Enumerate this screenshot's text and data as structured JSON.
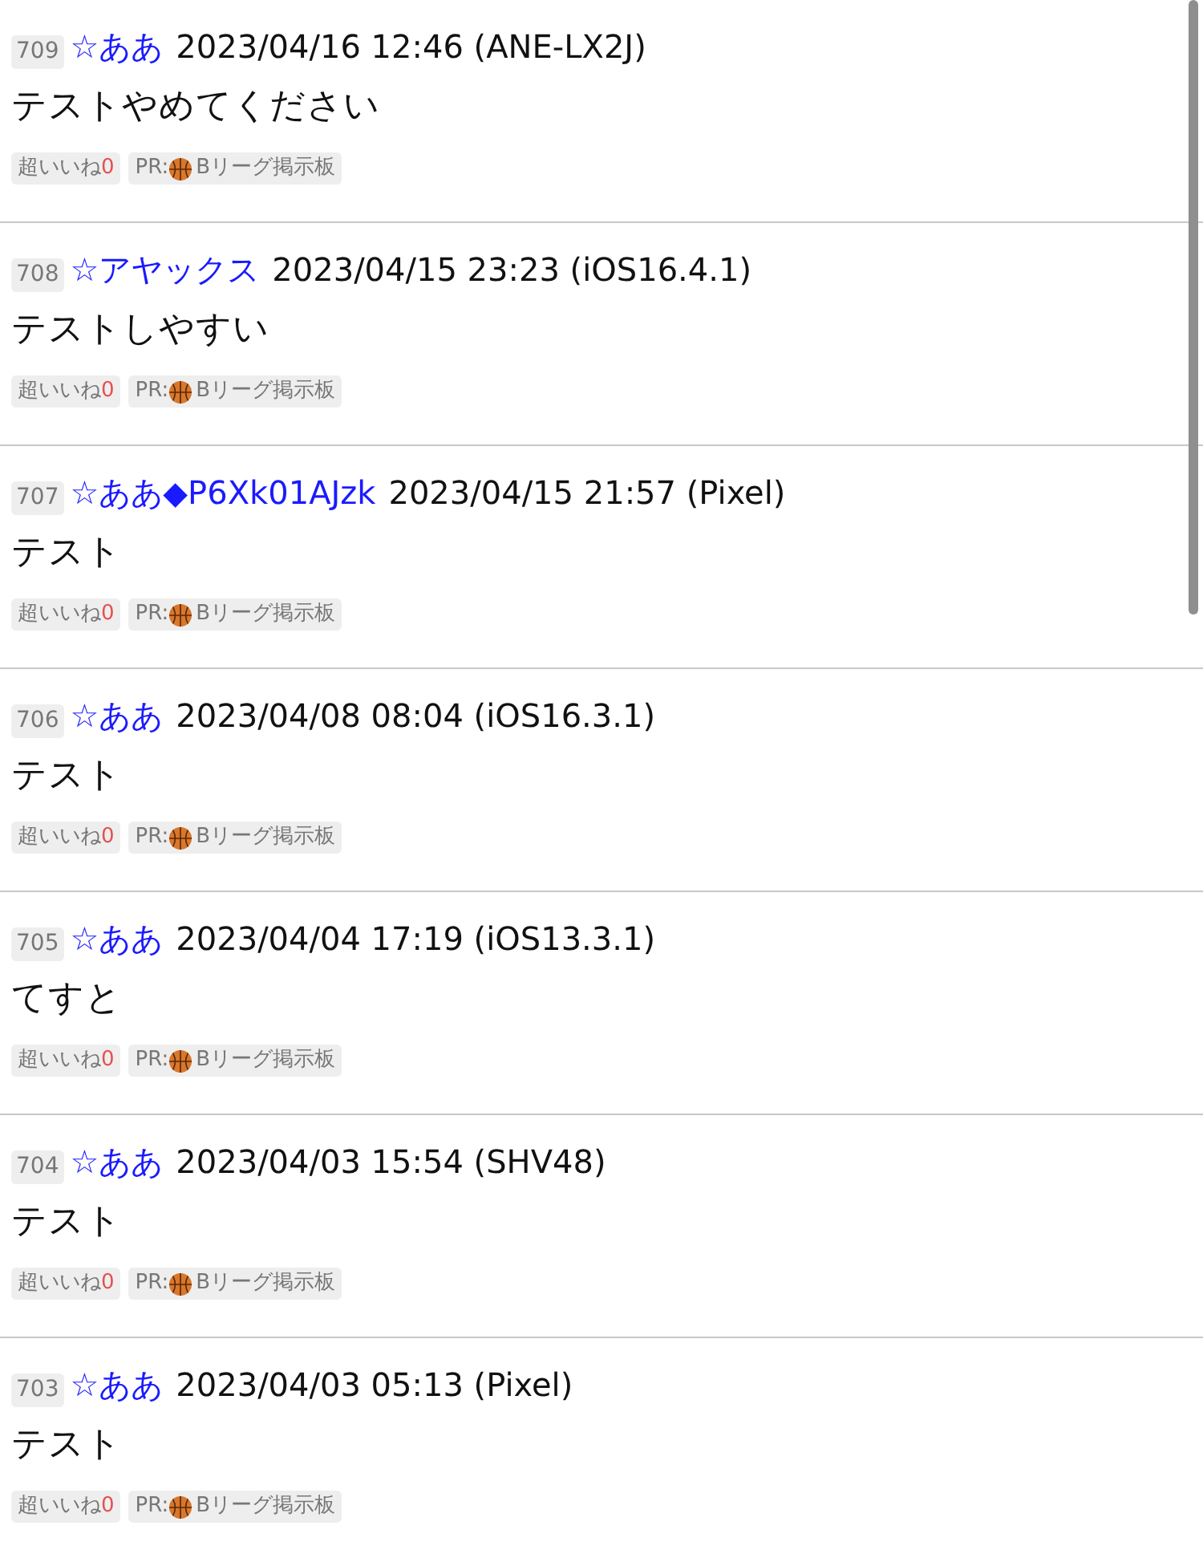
{
  "posts": [
    {
      "number": "709",
      "name": "☆ああ",
      "meta": "2023/04/16 12:46 (ANE-LX2J)",
      "body": "テストやめてください",
      "like_label": "超いいね",
      "like_count": "0",
      "pr_prefix": "PR:",
      "pr_text": "Bリーグ掲示板"
    },
    {
      "number": "708",
      "name": "☆アヤックス",
      "meta": "2023/04/15 23:23 (iOS16.4.1)",
      "body": "テストしやすい",
      "like_label": "超いいね",
      "like_count": "0",
      "pr_prefix": "PR:",
      "pr_text": "Bリーグ掲示板"
    },
    {
      "number": "707",
      "name": "☆ああ◆P6Xk01AJzk",
      "meta": "2023/04/15 21:57 (Pixel)",
      "body": "テスト",
      "like_label": "超いいね",
      "like_count": "0",
      "pr_prefix": "PR:",
      "pr_text": "Bリーグ掲示板"
    },
    {
      "number": "706",
      "name": "☆ああ",
      "meta": "2023/04/08 08:04 (iOS16.3.1)",
      "body": "テスト",
      "like_label": "超いいね",
      "like_count": "0",
      "pr_prefix": "PR:",
      "pr_text": "Bリーグ掲示板"
    },
    {
      "number": "705",
      "name": "☆ああ",
      "meta": "2023/04/04 17:19 (iOS13.3.1)",
      "body": "てすと",
      "like_label": "超いいね",
      "like_count": "0",
      "pr_prefix": "PR:",
      "pr_text": "Bリーグ掲示板"
    },
    {
      "number": "704",
      "name": "☆ああ",
      "meta": "2023/04/03 15:54 (SHV48)",
      "body": "テスト",
      "like_label": "超いいね",
      "like_count": "0",
      "pr_prefix": "PR:",
      "pr_text": "Bリーグ掲示板"
    },
    {
      "number": "703",
      "name": "☆ああ",
      "meta": "2023/04/03 05:13 (Pixel)",
      "body": "テスト",
      "like_label": "超いいね",
      "like_count": "0",
      "pr_prefix": "PR:",
      "pr_text": "Bリーグ掲示板"
    }
  ]
}
